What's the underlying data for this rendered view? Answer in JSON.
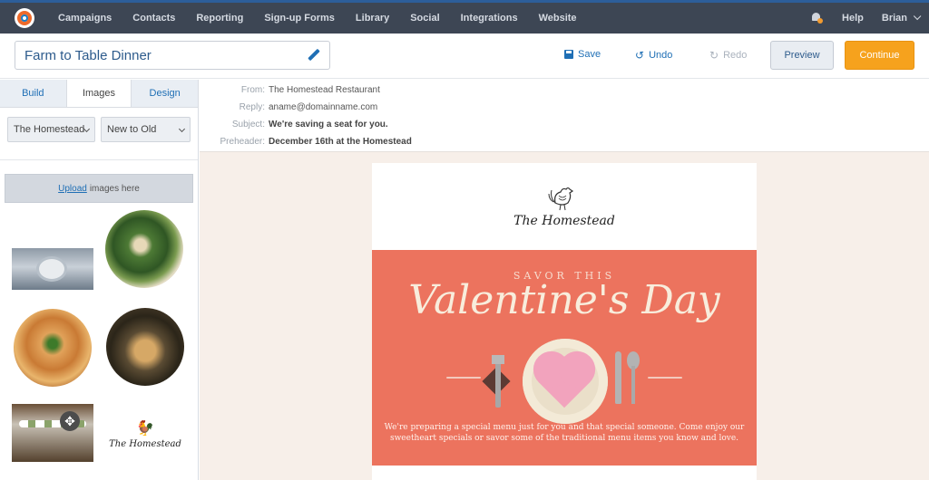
{
  "nav": {
    "items": [
      "Campaigns",
      "Contacts",
      "Reporting",
      "Sign-up Forms",
      "Library",
      "Social",
      "Integrations",
      "Website"
    ],
    "help": "Help",
    "user": "Brian"
  },
  "toolbar": {
    "campaign_name": "Farm to Table Dinner",
    "save": "Save",
    "undo": "Undo",
    "redo": "Redo",
    "preview": "Preview",
    "continue": "Continue"
  },
  "left_panel": {
    "tabs": [
      "Build",
      "Images",
      "Design"
    ],
    "active_tab": "Images",
    "folder_select": "The Homestead",
    "sort_select": "New to Old",
    "upload_link": "Upload",
    "upload_text": "images here",
    "thumb_logo_text": "The Homestead"
  },
  "email_headers": {
    "from_label": "From:",
    "from": "The Homestead Restaurant",
    "reply_label": "Reply:",
    "reply": "aname@domainname.com",
    "subject_label": "Subject:",
    "subject": "We're saving a seat for you.",
    "preheader_label": "Preheader:",
    "preheader": "December 16th at the Homestead"
  },
  "email_body": {
    "brand": "The Homestead",
    "eyebrow": "SAVOR THIS",
    "headline": "Valentine's Day",
    "body_text": "We're preparing a special menu just for you and that special someone. Come enjoy our sweetheart specials or savor some of the traditional menu items you know and love."
  },
  "colors": {
    "nav_bg": "#3d4654",
    "accent": "#1f6fb5",
    "continue": "#f6a21d",
    "hero": "#ec735e"
  }
}
